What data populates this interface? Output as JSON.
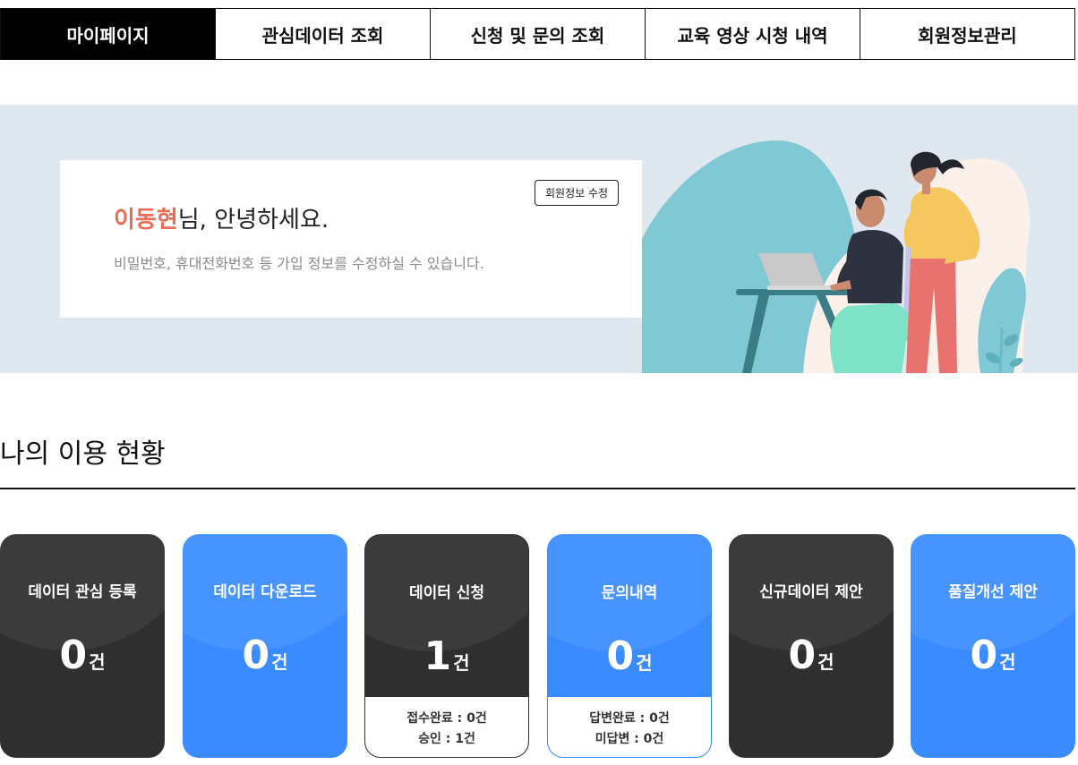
{
  "tabs": [
    {
      "label": "마이페이지",
      "active": true
    },
    {
      "label": "관심데이터 조회",
      "active": false
    },
    {
      "label": "신청 및 문의 조회",
      "active": false
    },
    {
      "label": "교육 영상 시청 내역",
      "active": false
    },
    {
      "label": "회원정보관리",
      "active": false
    }
  ],
  "greeting": {
    "name": "이동현",
    "suffix": "님, 안녕하세요.",
    "description": "비밀번호, 휴대전화번호 등 가입 정보를 수정하실 수 있습니다.",
    "edit_button": "회원정보 수정"
  },
  "section": {
    "title": "나의 이용 현황"
  },
  "cards": [
    {
      "label": "데이터 관심 등록",
      "count": "0",
      "unit": "건",
      "style": "dark"
    },
    {
      "label": "데이터 다운로드",
      "count": "0",
      "unit": "건",
      "style": "blue"
    },
    {
      "label": "데이터 신청",
      "count": "1",
      "unit": "건",
      "style": "dark",
      "details": [
        "접수완료 : 0건",
        "승인 : 1건"
      ]
    },
    {
      "label": "문의내역",
      "count": "0",
      "unit": "건",
      "style": "blue",
      "details": [
        "답변완료 : 0건",
        "미답변 : 0건"
      ]
    },
    {
      "label": "신규데이터 제안",
      "count": "0",
      "unit": "건",
      "style": "dark"
    },
    {
      "label": "품질개선 제안",
      "count": "0",
      "unit": "건",
      "style": "blue"
    }
  ],
  "colors": {
    "accent_name": "#ec6b55",
    "card_dark": "#2f2f2f",
    "card_blue": "#3a8bff",
    "hero_bg": "#dfe8ee"
  }
}
